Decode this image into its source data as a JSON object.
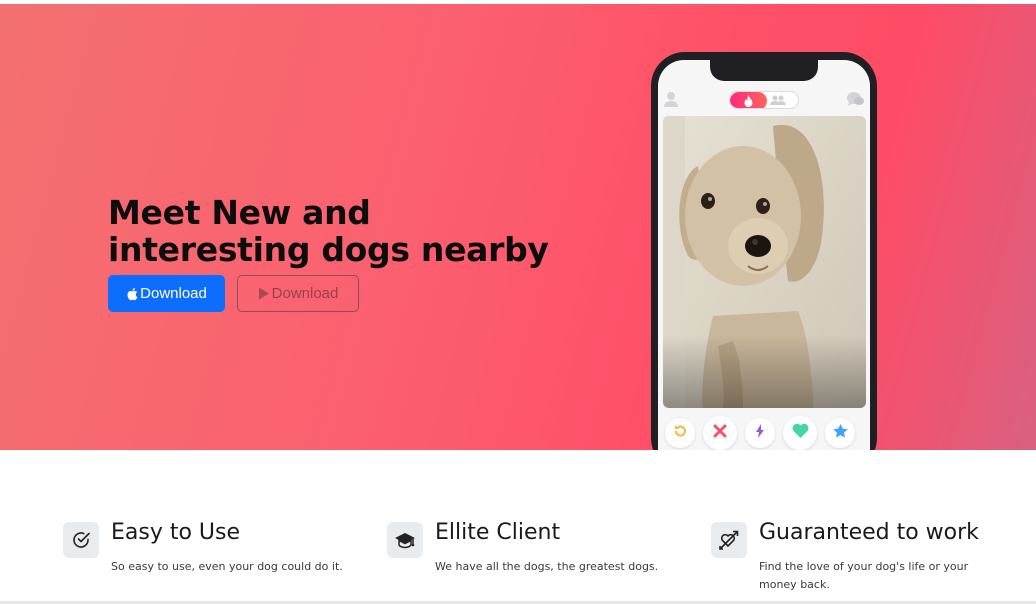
{
  "hero": {
    "title_line1": "Meet New and",
    "title_line2": "interesting dogs nearby",
    "apple_button_label": "Download",
    "play_button_label": "Download",
    "apple_icon": "apple-icon",
    "play_icon": "play-store-icon"
  },
  "phone": {
    "toggle_active_icon": "flame-icon",
    "toggle_inactive_icon": "group-icon",
    "actions": [
      "rewind",
      "nope",
      "boost",
      "like",
      "super-like"
    ]
  },
  "features": [
    {
      "title": "Easy to Use",
      "text": "So easy to use, even your dog could do it.",
      "icon": "check-circle-icon"
    },
    {
      "title": "Ellite Client",
      "text": "We have all the dogs, the greatest dogs.",
      "icon": "graduation-cap-icon"
    },
    {
      "title": "Guaranteed to work",
      "text": "Find the love of your dog's life or your money back.",
      "icon": "heart-arrow-icon"
    }
  ],
  "colors": {
    "hero_gradient_start": "#f37070",
    "hero_gradient_end": "#d96080",
    "primary_button": "#0d6efd",
    "rewind": "#f5b748",
    "nope": "#fd5068",
    "boost": "#915dd1",
    "like": "#45d5a6",
    "super_like": "#3ca4ff"
  }
}
